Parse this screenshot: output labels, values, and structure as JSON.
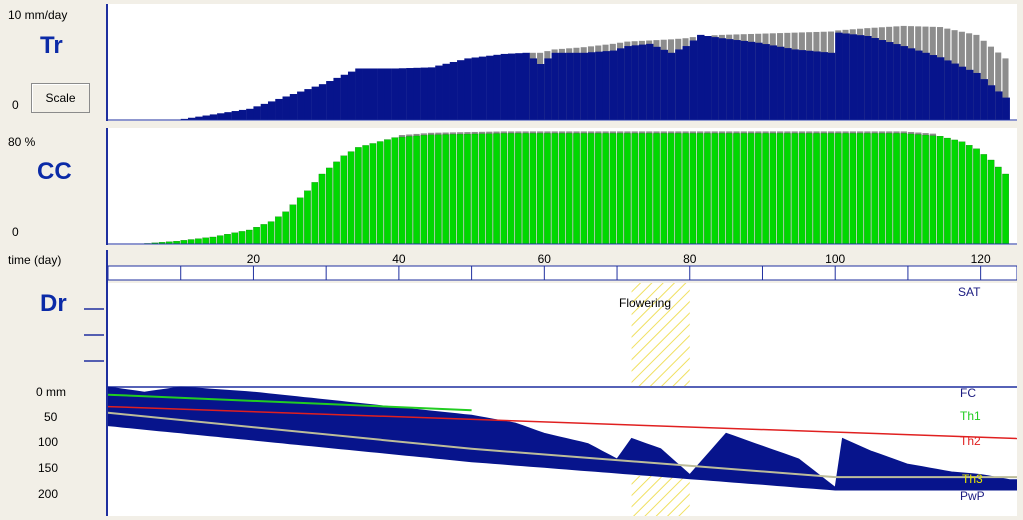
{
  "top_panel": {
    "title": "Tr",
    "unit_top": "10 mm/day",
    "unit_zero": "0",
    "scale_button": "Scale"
  },
  "cc_panel": {
    "title": "CC",
    "unit_top": "80 %",
    "unit_zero": "0"
  },
  "axis_panel": {
    "label": "time (day)"
  },
  "dr_panel": {
    "title": "Dr",
    "y_ticks": [
      "0 mm",
      "50",
      "100",
      "150",
      "200"
    ],
    "right_labels": {
      "sat": "SAT",
      "fc": "FC",
      "th1": "Th1",
      "th2": "Th2",
      "th3": "Th3",
      "pwp": "PwP"
    },
    "flowering_label": "Flowering"
  },
  "colors": {
    "blue": "#07148c",
    "gray": "#8d8d8d",
    "green": "#00d800",
    "red": "#e02020",
    "yellow": "#ffff00",
    "axis": "#1f2f9f"
  },
  "chart_data": [
    {
      "type": "bar",
      "title": "Tr",
      "ylabel": "mm/day",
      "ylim": [
        0,
        10
      ],
      "x": [
        10,
        20,
        30,
        35,
        40,
        45,
        50,
        55,
        58,
        60,
        62,
        66,
        70,
        72,
        75,
        78,
        80,
        82,
        85,
        90,
        95,
        100,
        101,
        105,
        110,
        115,
        120,
        124
      ],
      "actual": [
        0.0,
        1.0,
        3.2,
        4.6,
        4.6,
        4.7,
        5.5,
        5.9,
        6.0,
        5.0,
        6.0,
        6.0,
        6.2,
        6.6,
        6.8,
        6.0,
        6.6,
        7.6,
        7.3,
        6.9,
        6.3,
        6.0,
        7.8,
        7.5,
        6.6,
        5.6,
        4.2,
        2.0
      ],
      "potential": [
        0.0,
        1.0,
        3.2,
        4.6,
        4.6,
        4.7,
        5.5,
        5.9,
        6.0,
        6.0,
        6.3,
        6.5,
        6.8,
        7.0,
        7.1,
        7.2,
        7.3,
        7.5,
        7.6,
        7.7,
        7.8,
        7.9,
        8.0,
        8.2,
        8.4,
        8.3,
        7.6,
        5.5
      ]
    },
    {
      "type": "bar",
      "title": "CC",
      "ylabel": "%",
      "ylim": [
        0,
        80
      ],
      "x": [
        5,
        10,
        15,
        20,
        23,
        25,
        28,
        30,
        33,
        35,
        40,
        45,
        50,
        55,
        60,
        70,
        80,
        90,
        100,
        110,
        115,
        118,
        120,
        122,
        124
      ],
      "values": [
        0,
        2,
        5,
        10,
        16,
        23,
        38,
        50,
        63,
        69,
        76,
        78,
        78.5,
        79,
        79,
        79,
        79,
        79,
        79,
        79,
        77,
        73,
        68,
        60,
        50
      ]
    },
    {
      "type": "area",
      "title": "Dr",
      "xlabel": "time (day)",
      "xlim": [
        0,
        125
      ],
      "x_ticks": [
        20,
        40,
        60,
        80,
        100,
        120
      ],
      "ylabel": "mm",
      "ylim_below_fc": [
        0,
        200
      ],
      "x": [
        0,
        5,
        10,
        20,
        30,
        40,
        50,
        56,
        60,
        66,
        70,
        72,
        76,
        80,
        85,
        90,
        95,
        100,
        101,
        105,
        110,
        116,
        120,
        124
      ],
      "depletion": [
        0,
        10,
        0,
        10,
        25,
        40,
        55,
        70,
        90,
        110,
        140,
        100,
        120,
        170,
        90,
        115,
        140,
        195,
        100,
        125,
        150,
        165,
        170,
        180
      ],
      "thresholds": {
        "th1": {
          "x": [
            0,
            50
          ],
          "y": [
            15,
            45
          ]
        },
        "th2": {
          "x": [
            0,
            125
          ],
          "y": [
            38,
            100
          ]
        },
        "th3": {
          "x": [
            0,
            50,
            100,
            125
          ],
          "y": [
            50,
            120,
            175,
            175
          ]
        }
      },
      "flowering_window": [
        72,
        80
      ]
    }
  ]
}
